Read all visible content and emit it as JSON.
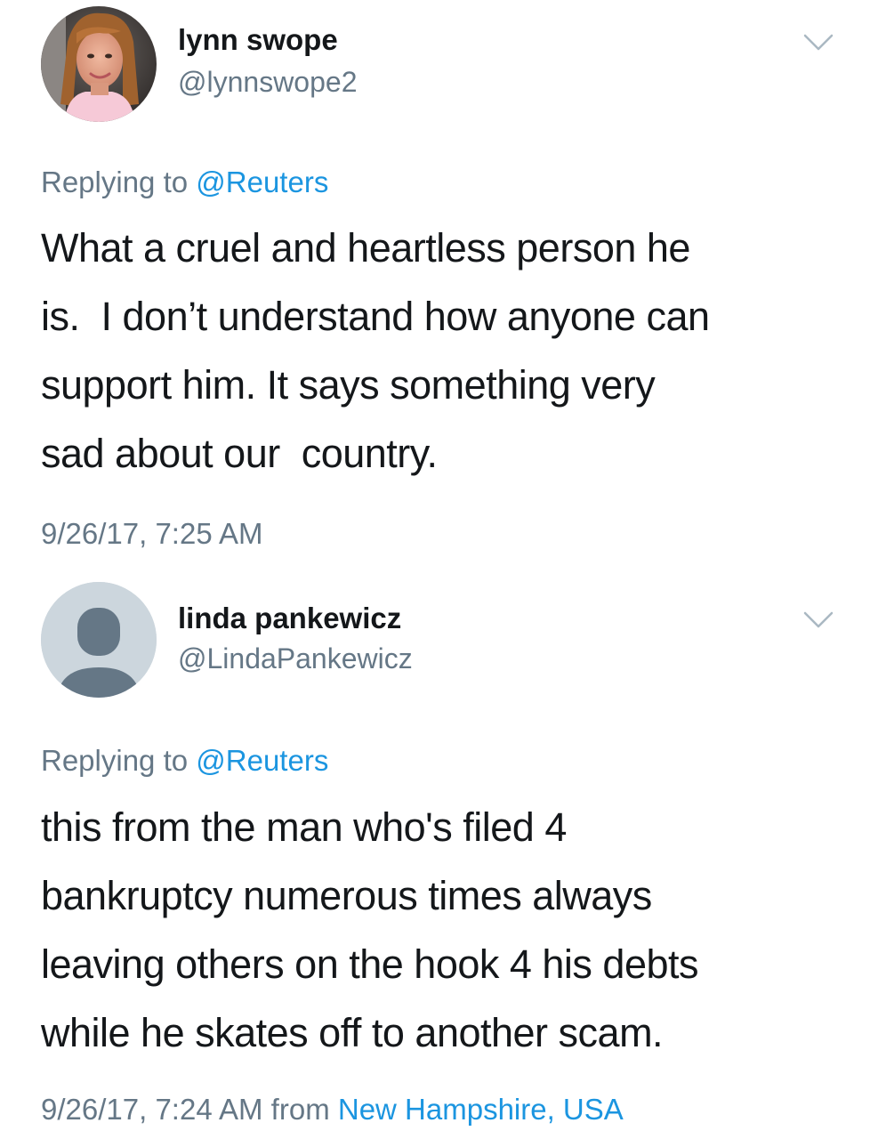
{
  "tweets": [
    {
      "display_name": "lynn swope",
      "handle": "@lynnswope2",
      "avatar_icon": "profile-photo",
      "menu_icon": "chevron-down-icon",
      "replying_prefix": "Replying to ",
      "replying_to": "@Reuters",
      "text_lines": [
        "What a cruel and heartless person he",
        "is.  I don’t understand how anyone can",
        "support him. It says something very",
        "sad about our  country."
      ],
      "timestamp": "9/26/17, 7:25 AM",
      "location_prefix": "",
      "location": ""
    },
    {
      "display_name": "linda pankewicz",
      "handle": "@LindaPankewicz",
      "avatar_icon": "default-avatar-icon",
      "menu_icon": "chevron-down-icon",
      "replying_prefix": "Replying to ",
      "replying_to": "@Reuters",
      "text_lines": [
        "this from the man who's filed 4",
        "bankruptcy numerous times always",
        "leaving others on the hook 4 his debts",
        "while he skates off to another scam."
      ],
      "timestamp": "9/26/17, 7:24 AM",
      "location_prefix": " from ",
      "location": "New Hampshire, USA"
    }
  ],
  "colors": {
    "text": "#14171a",
    "secondary": "#657786",
    "link": "#1b95e0",
    "default_avatar_bg": "#ccd6dd",
    "default_avatar_fg": "#657786"
  }
}
